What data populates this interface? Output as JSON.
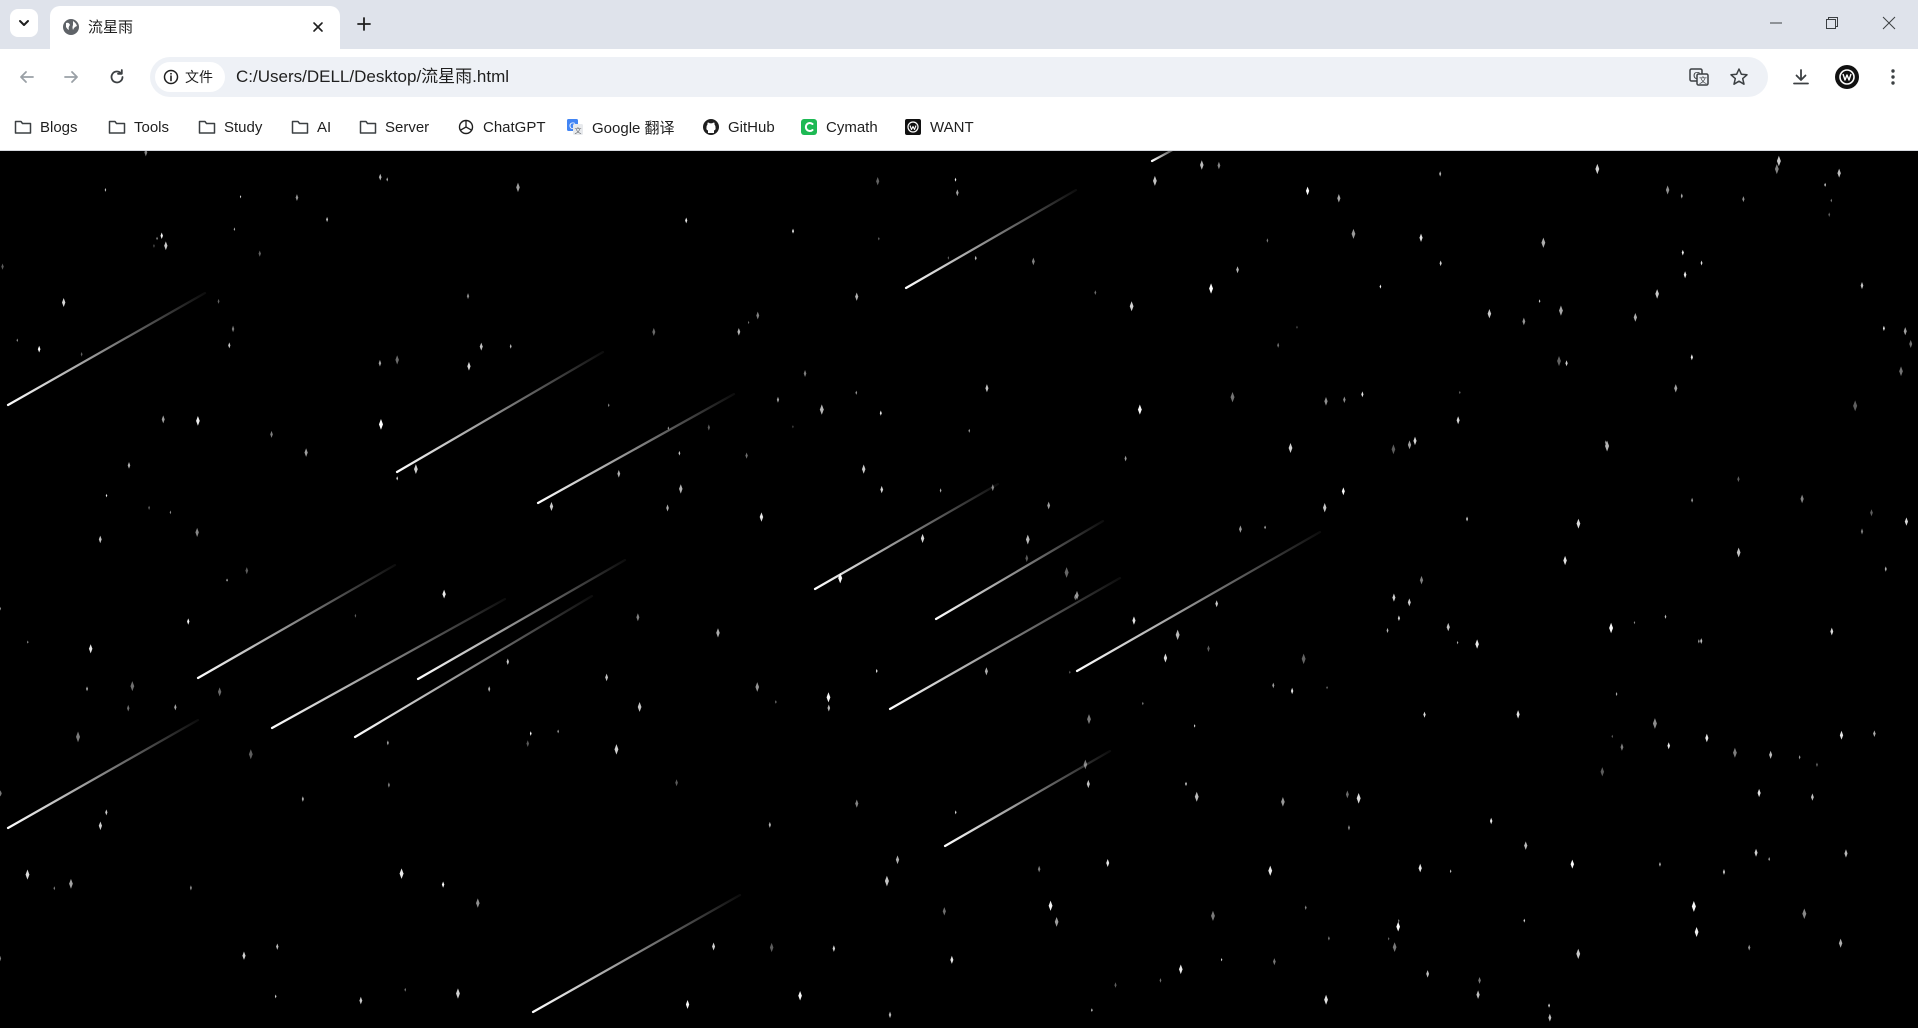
{
  "tab": {
    "title": "流星雨"
  },
  "toolbar": {
    "site_label": "文件",
    "url": "C:/Users/DELL/Desktop/流星雨.html"
  },
  "bookmarks": [
    {
      "label": "Blogs",
      "icon": "folder-icon"
    },
    {
      "label": "Tools",
      "icon": "folder-icon"
    },
    {
      "label": "Study",
      "icon": "folder-icon"
    },
    {
      "label": "AI",
      "icon": "folder-icon"
    },
    {
      "label": "Server",
      "icon": "folder-icon"
    },
    {
      "label": "ChatGPT",
      "icon": "openai-icon"
    },
    {
      "label": "Google 翻译",
      "icon": "google-translate-icon"
    },
    {
      "label": "GitHub",
      "icon": "github-icon"
    },
    {
      "label": "Cymath",
      "icon": "cymath-icon"
    },
    {
      "label": "WANT",
      "icon": "want-icon"
    }
  ],
  "colors": {
    "tabstrip": "#dfe3eb",
    "page_background": "#000000",
    "star": "#ffffff"
  }
}
